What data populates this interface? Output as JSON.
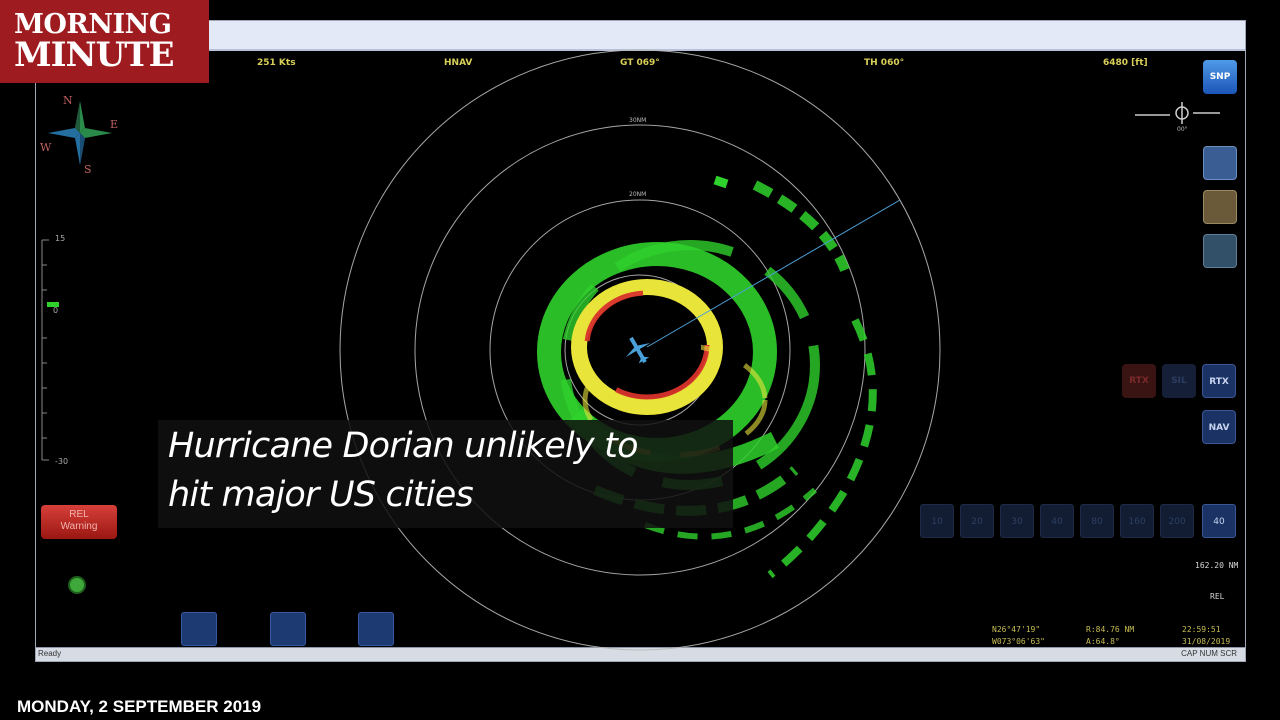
{
  "brand": {
    "line1": "MORNING",
    "line2": "MINUTE"
  },
  "date": "MONDAY, 2 SEPTEMBER 2019",
  "headline": {
    "line1": "Hurricane Dorian unlikely to",
    "line2": "hit major US cities"
  },
  "radar": {
    "header": {
      "speed": "251 Kts",
      "nav": "HNAV",
      "gt": "GT 069°",
      "th": "TH 060°",
      "alt": "6480 [ft]"
    },
    "range_labels": [
      "30NM",
      "20NM"
    ],
    "compass": [
      "N",
      "E",
      "W",
      "S"
    ],
    "scale": {
      "top": "15",
      "mid": "0",
      "bottom": "-30"
    },
    "warning": {
      "line1": "REL",
      "line2": "Warning"
    },
    "tilt": "00°",
    "right_buttons": {
      "snp": "SNP",
      "rtx_dim": "RTX",
      "sil": "SIL",
      "rtx": "RTX",
      "nav": "NAV"
    },
    "zoom": [
      "10",
      "20",
      "30",
      "40",
      "80",
      "160",
      "200",
      "40"
    ],
    "range_readout": "162.20 NM",
    "mode": "REL",
    "coords": {
      "lat": "N26°47'19\"",
      "lon": "W073°06'63\"",
      "range": "R:84.76 NM",
      "azimuth": "A:64.8°",
      "time": "22:59:51",
      "date": "31/08/2019"
    },
    "status": {
      "left": "Ready",
      "right": "CAP NUM SCR"
    },
    "colors": {
      "echo_green": "#2fd12c",
      "echo_yellow": "#e8e43a",
      "echo_red": "#d8332b",
      "brand_red": "#9e1b1f"
    }
  }
}
